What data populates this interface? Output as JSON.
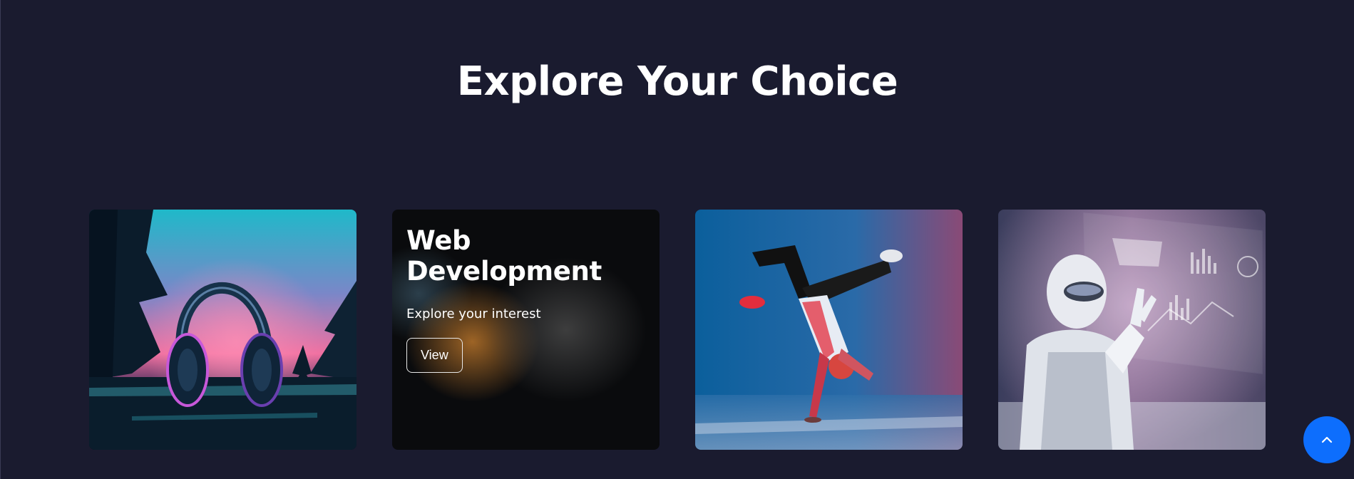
{
  "section": {
    "title": "Explore Your Choice"
  },
  "cards": [
    {
      "image": "headphones-neon-forest-image"
    },
    {
      "image": "blurred-dark-bokeh-image",
      "title": "Web Development",
      "subtitle": "Explore your interest",
      "button_label": "View"
    },
    {
      "image": "breakdancer-handstand-image"
    },
    {
      "image": "robot-holographic-interface-image"
    }
  ],
  "scroll_to_top": {
    "icon": "chevron-up-icon",
    "color": "#0d6efd"
  },
  "colors": {
    "background": "#1a1b2f",
    "text": "#ffffff",
    "accent": "#0d6efd"
  }
}
